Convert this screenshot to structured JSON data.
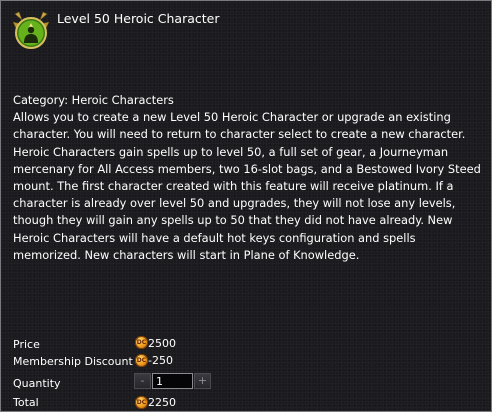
{
  "item": {
    "icon": "heroic-character-badge-icon",
    "title": "Level 50 Heroic Character"
  },
  "description": {
    "category": "Category: Heroic Characters",
    "body": "Allows you to create a new Level 50 Heroic Character or upgrade an existing character. You will need to return to character select to create a new character. Heroic Characters gain spells up to level 50, a full set of gear, a Journeyman mercenary for All Access members, two 16-slot bags, and a Bestowed Ivory Steed mount. The first character created with this feature will receive platinum. If a character is already over level 50 and upgrades, they will not lose any levels, though they will gain any spells up to 50 that they did not have already. New Heroic Characters will have a default hot keys configuration and spells memorized. New characters will start in Plane of Knowledge."
  },
  "pricing": {
    "price_label": "Price",
    "price_value": "2500",
    "discount_label": "Membership Discount",
    "discount_value": "-250",
    "quantity_label": "Quantity",
    "quantity_value": "1",
    "minus_label": "-",
    "plus_label": "+",
    "total_label": "Total",
    "total_value": "2250",
    "currency_icon": "daybreak-cash-coin-icon",
    "currency_glyph": "DC"
  },
  "colors": {
    "background": "#1b1b1f",
    "border": "#7a7a80",
    "text": "#ffffff",
    "coin": "#f0a020"
  }
}
